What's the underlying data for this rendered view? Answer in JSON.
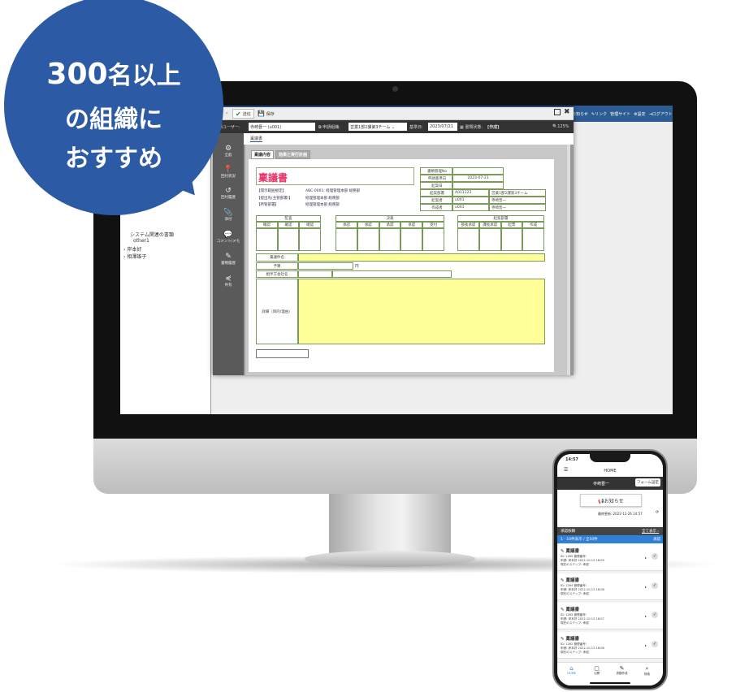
{
  "bubble": {
    "line1": "300名以上",
    "line2": "の組織に",
    "line3": "おすすめ",
    "color": "#2c5aa5"
  },
  "desktop": {
    "header_links": [
      "お知らせ",
      "✎リンク",
      "管理サイト",
      "⚙設定",
      "⇥ログアウト"
    ],
    "tree": [
      "システム関連の書類",
      "other1",
      "岸本好",
      "相澤雄子"
    ],
    "window": {
      "toolbar": {
        "send": "送信",
        "save": "保存"
      },
      "fields": {
        "user_label": "申請ユーザー:",
        "user_value": "寺崎晋一 (u001)",
        "org_label": "申請組織:",
        "org_value": "営業1部2課第3チーム",
        "date_label": "基準日:",
        "date_value": "2023/07/21",
        "status_label": "書類状態:",
        "status_value": "[作成]",
        "zoom": "125%"
      },
      "doc_tab": "稟議書",
      "form_tabs": [
        "稟議内容",
        "効果と実行計画"
      ],
      "sidebar": [
        "全般",
        "回付状況",
        "回付履歴",
        "添付",
        "コメント/メモ",
        "書類履歴",
        "共有"
      ],
      "form": {
        "title": "稟議書",
        "info": [
          [
            "【開示範囲規定】",
            "ABC-0001: 経理管理本部 総務部"
          ],
          [
            "【提出先(主管部署)】",
            "経理管理本部 総務部"
          ],
          [
            "【所管部署】",
            "経理管理本部 総務部"
          ]
        ],
        "meta": [
          [
            "書類管理No",
            "",
            " "
          ],
          [
            "申請基準日",
            "2023-07-21",
            ""
          ],
          [
            "起案日",
            "",
            ""
          ],
          [
            "起案部署",
            "A011123",
            "営業1部2課第3チーム"
          ],
          [
            "起案者",
            "u001",
            "寺崎晋一"
          ],
          [
            "作成者",
            "u001",
            "寺崎晋一"
          ]
        ],
        "audit": {
          "title": "監査",
          "cols": [
            "確認",
            "確認",
            "確認"
          ]
        },
        "decision": {
          "title": "決裁",
          "cols": [
            "承認",
            "承認",
            "承認",
            "承認",
            "受付"
          ]
        },
        "dept": {
          "title": "起案部署",
          "cols": [
            "部長承認",
            "課長承認",
            "起票",
            "作成"
          ]
        },
        "rows": {
          "subject": "稟議件名",
          "budget": "予算",
          "yen": "円",
          "partner": "相手方会社名",
          "detail": "詳細（目的/理由）"
        }
      }
    }
  },
  "phone": {
    "time": "14:57",
    "title": "HOME",
    "user": "寺崎晋一",
    "form_settings": "フォーム設定",
    "notice": "📢お知らせ",
    "updated": "最終更新: 2022-12-26 14:57",
    "section": "承認依頼",
    "show_all": "全て表示 ›",
    "range": "1 - 10件表示 / 全50件",
    "approve_col": "承認",
    "items": [
      {
        "title": "稟議書",
        "id": "ID: 1265 管理番号:",
        "applicant": "申請: 岸本好 2022-10-12 18:09",
        "step": "現在のステップ: 承認"
      },
      {
        "title": "稟議書",
        "id": "ID: 1264 管理番号:",
        "applicant": "申請: 岸本好 2022-10-12 18:08",
        "step": "現在のステップ: 承認"
      },
      {
        "title": "稟議書",
        "id": "ID: 1263 管理番号:",
        "applicant": "申請: 岸本好 2022-10-12 18:07",
        "step": "現在のステップ: 承認"
      },
      {
        "title": "稟議書",
        "id": "ID: 1262 管理番号:",
        "applicant": "申請: 岸本好 2022-10-12 18:06",
        "step": "現在のステップ: 承認"
      }
    ],
    "nav": [
      "HOME",
      "公開",
      "書類作成",
      "検索"
    ],
    "accent": "#2f80d8"
  }
}
